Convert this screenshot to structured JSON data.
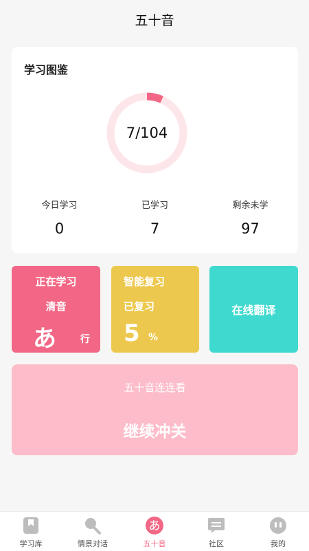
{
  "header": {
    "title": "五十音"
  },
  "study_card": {
    "title": "学习图鉴",
    "progress_text": "7/104",
    "progress_fraction": 0.067,
    "stats": [
      {
        "label": "今日学习",
        "value": "0"
      },
      {
        "label": "已学习",
        "value": "7"
      },
      {
        "label": "剩余未学",
        "value": "97"
      }
    ]
  },
  "tiles": {
    "learning": {
      "title": "正在学习",
      "subtitle": "清音",
      "kana": "あ",
      "kana_suffix": "行"
    },
    "review": {
      "title": "智能复习",
      "subtitle": "已复习",
      "percent": "5",
      "percent_sign": "%"
    },
    "translate": {
      "label": "在线翻译"
    }
  },
  "banner": {
    "subtitle": "五十音连连看",
    "action": "继续冲关"
  },
  "tabbar": {
    "items": [
      {
        "label": "学习库",
        "icon": "bookmark-icon"
      },
      {
        "label": "情景对话",
        "icon": "microphone-icon"
      },
      {
        "label": "五十音",
        "icon": "kana-a-icon",
        "glyph": "あ"
      },
      {
        "label": "社区",
        "icon": "chat-icon"
      },
      {
        "label": "我的",
        "icon": "user-icon"
      }
    ],
    "active_index": 2
  },
  "colors": {
    "accent_pink": "#f26785",
    "ring_track": "#fde6ea",
    "ring_fill": "#f26785",
    "tile_yellow": "#edc84e",
    "tile_teal": "#3fd9d0",
    "banner_pink": "#fdbcc9",
    "icon_gray": "#bdbdbd"
  }
}
